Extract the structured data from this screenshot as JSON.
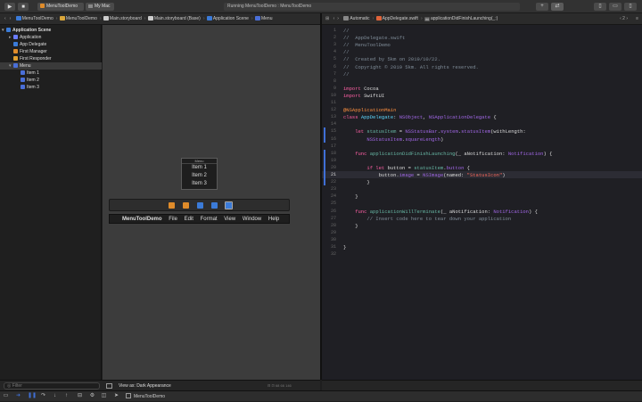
{
  "toolbar": {
    "scheme": "MenuToolDemo",
    "destination": "My Mac",
    "status": "Running MenuToolDemo : MenuToolDemo",
    "add": "+",
    "swap": "⇄"
  },
  "jump_left": [
    "MenuToolDemo",
    "MenuToolDemo",
    "Main.storyboard",
    "Main.storyboard (Base)",
    "Application Scene",
    "Menu"
  ],
  "jump_right": [
    "Automatic",
    "AppDelegate.swift",
    "applicationDidFinishLaunching(_:)"
  ],
  "jump_right_count": "2",
  "outline": [
    {
      "label": "Application Scene",
      "indent": 0,
      "bold": true,
      "color": "#3b7bd8",
      "disclosure": "▾"
    },
    {
      "label": "Application",
      "indent": 1,
      "color": "#6a7cff",
      "disclosure": "▸"
    },
    {
      "label": "App Delegate",
      "indent": 1,
      "color": "#3b7bd8",
      "disclosure": ""
    },
    {
      "label": "First Manager",
      "indent": 1,
      "color": "#e08c2a",
      "disclosure": ""
    },
    {
      "label": "First Responder",
      "indent": 1,
      "color": "#e0a030",
      "disclosure": ""
    },
    {
      "label": "Menu",
      "indent": 1,
      "color": "#4a6fd8",
      "disclosure": "▾",
      "selected": true
    },
    {
      "label": "Item 1",
      "indent": 2,
      "color": "#4a6fd8",
      "disclosure": ""
    },
    {
      "label": "Item 2",
      "indent": 2,
      "color": "#4a6fd8",
      "disclosure": ""
    },
    {
      "label": "Item 3",
      "indent": 2,
      "color": "#4a6fd8",
      "disclosure": ""
    }
  ],
  "menu_window": {
    "title": "Menu",
    "items": [
      "Item 1",
      "Item 2",
      "Item 3"
    ]
  },
  "main_menu": [
    "MenuToolDemo",
    "File",
    "Edit",
    "Format",
    "View",
    "Window",
    "Help"
  ],
  "canvas_icons": [
    "#e08c2a",
    "#e08c2a",
    "#3b7bd8",
    "#3b7bd8",
    "#3b7bd8",
    "#777777"
  ],
  "bottom": {
    "filter_placeholder": "Filter",
    "view_as": "View as: Dark Appearance",
    "zoom": [
      "68",
      "66",
      "146"
    ]
  },
  "debug": {
    "target": "MenuToolDemo"
  },
  "line_numbers": [
    "1",
    "2",
    "3",
    "4",
    "5",
    "6",
    "7",
    "8",
    "9",
    "10",
    "11",
    "12",
    "13",
    "14",
    "15",
    "16",
    "17",
    "18",
    "19",
    "20",
    "21",
    "22",
    "23",
    "24",
    "25",
    "26",
    "27",
    "28",
    "29",
    "30",
    "31",
    "32"
  ],
  "code": [
    [
      {
        "c": "cm",
        "t": "//"
      }
    ],
    [
      {
        "c": "cm",
        "t": "//  AppDelegate.swift"
      }
    ],
    [
      {
        "c": "cm",
        "t": "//  MenuToolDemo"
      }
    ],
    [
      {
        "c": "cm",
        "t": "//"
      }
    ],
    [
      {
        "c": "cm",
        "t": "//  Created by 5km on 2019/10/22."
      }
    ],
    [
      {
        "c": "cm",
        "t": "//  Copyright © 2019 5km. All rights reserved."
      }
    ],
    [
      {
        "c": "cm",
        "t": "//"
      }
    ],
    [],
    [
      {
        "c": "kw",
        "t": "import"
      },
      {
        "c": "",
        "t": " Cocoa"
      }
    ],
    [
      {
        "c": "kw",
        "t": "import"
      },
      {
        "c": "",
        "t": " SwiftUI"
      }
    ],
    [],
    [
      {
        "c": "at",
        "t": "@NSApplicationMain"
      }
    ],
    [
      {
        "c": "kw",
        "t": "class"
      },
      {
        "c": "",
        "t": " "
      },
      {
        "c": "tp",
        "t": "AppDelegate"
      },
      {
        "c": "",
        "t": ": "
      },
      {
        "c": "pl",
        "t": "NSObject"
      },
      {
        "c": "",
        "t": ", "
      },
      {
        "c": "pl",
        "t": "NSApplicationDelegate"
      },
      {
        "c": "",
        "t": " {"
      }
    ],
    [],
    [
      {
        "c": "",
        "t": "    "
      },
      {
        "c": "kw",
        "t": "let"
      },
      {
        "c": "",
        "t": " "
      },
      {
        "c": "fn",
        "t": "statusItem"
      },
      {
        "c": "",
        "t": " = "
      },
      {
        "c": "pl",
        "t": "NSStatusBar"
      },
      {
        "c": "",
        "t": "."
      },
      {
        "c": "pl",
        "t": "system"
      },
      {
        "c": "",
        "t": "."
      },
      {
        "c": "pl",
        "t": "statusItem"
      },
      {
        "c": "",
        "t": "(withLength:"
      }
    ],
    [
      {
        "c": "",
        "t": "        "
      },
      {
        "c": "pl",
        "t": "NSStatusItem"
      },
      {
        "c": "",
        "t": "."
      },
      {
        "c": "pl",
        "t": "squareLength"
      },
      {
        "c": "",
        "t": ")"
      }
    ],
    [],
    [
      {
        "c": "",
        "t": "    "
      },
      {
        "c": "kw",
        "t": "func"
      },
      {
        "c": "",
        "t": " "
      },
      {
        "c": "fn",
        "t": "applicationDidFinishLaunching"
      },
      {
        "c": "",
        "t": "(_ aNotification: "
      },
      {
        "c": "pl",
        "t": "Notification"
      },
      {
        "c": "",
        "t": ") {"
      }
    ],
    [],
    [
      {
        "c": "",
        "t": "        "
      },
      {
        "c": "kw",
        "t": "if let"
      },
      {
        "c": "",
        "t": " button = "
      },
      {
        "c": "fn",
        "t": "statusItem"
      },
      {
        "c": "",
        "t": "."
      },
      {
        "c": "pl",
        "t": "button"
      },
      {
        "c": "",
        "t": " {"
      }
    ],
    [
      {
        "c": "",
        "t": "            button."
      },
      {
        "c": "pl",
        "t": "image"
      },
      {
        "c": "",
        "t": " = "
      },
      {
        "c": "pl",
        "t": "NSImage"
      },
      {
        "c": "",
        "t": "(named: "
      },
      {
        "c": "str",
        "t": "\"StatusIcon\""
      },
      {
        "c": "",
        "t": ")"
      }
    ],
    [
      {
        "c": "",
        "t": "        }"
      }
    ],
    [],
    [
      {
        "c": "",
        "t": "    }"
      }
    ],
    [],
    [
      {
        "c": "",
        "t": "    "
      },
      {
        "c": "kw",
        "t": "func"
      },
      {
        "c": "",
        "t": " "
      },
      {
        "c": "fn",
        "t": "applicationWillTerminate"
      },
      {
        "c": "",
        "t": "(_ aNotification: "
      },
      {
        "c": "pl",
        "t": "Notification"
      },
      {
        "c": "",
        "t": ") {"
      }
    ],
    [
      {
        "c": "",
        "t": "        "
      },
      {
        "c": "cm",
        "t": "// Insert code here to tear down your application"
      }
    ],
    [
      {
        "c": "",
        "t": "    }"
      }
    ],
    [],
    [],
    [
      {
        "c": "",
        "t": "}"
      }
    ],
    []
  ],
  "current_line": "21"
}
